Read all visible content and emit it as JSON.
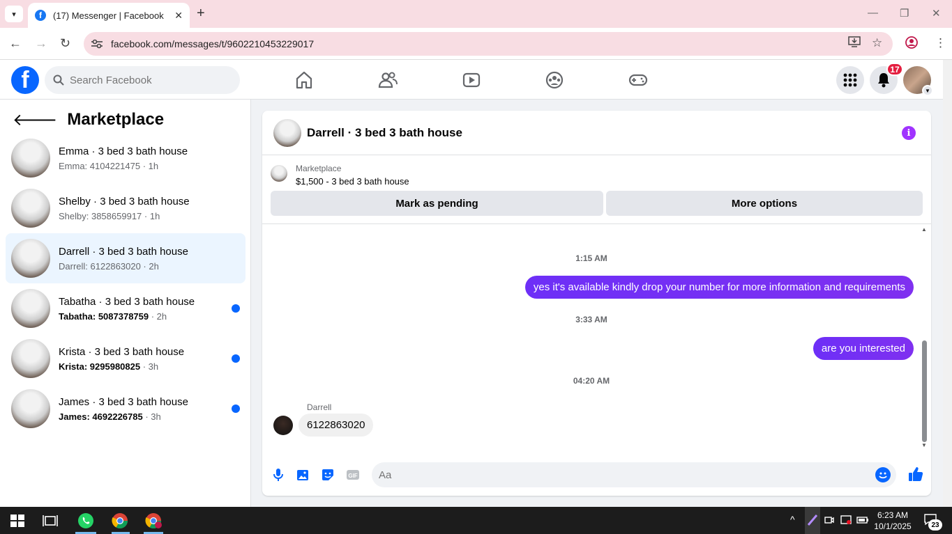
{
  "browser": {
    "tab_title": "(17) Messenger | Facebook",
    "url": "facebook.com/messages/t/9602210453229017"
  },
  "header": {
    "search_placeholder": "Search Facebook",
    "notifications_count": "17",
    "brand_color": "#0866ff"
  },
  "sidebar": {
    "title": "Marketplace",
    "conversations": [
      {
        "name": "Emma · 3 bed 3 bath house",
        "preview": "Emma: 4104221475",
        "time": " · 1h",
        "unread": false,
        "active": false
      },
      {
        "name": "Shelby · 3 bed 3 bath house",
        "preview": "Shelby: 3858659917",
        "time": " · 1h",
        "unread": false,
        "active": false
      },
      {
        "name": "Darrell · 3 bed 3 bath house",
        "preview": "Darrell: 6122863020",
        "time": " · 2h",
        "unread": false,
        "active": true
      },
      {
        "name": "Tabatha · 3 bed 3 bath house",
        "preview": "Tabatha: 5087378759",
        "time": " · 2h",
        "unread": true,
        "active": false
      },
      {
        "name": "Krista · 3 bed 3 bath house",
        "preview": "Krista: 9295980825",
        "time": " · 3h",
        "unread": true,
        "active": false
      },
      {
        "name": "James · 3 bed 3 bath house",
        "preview": "James: 4692226785",
        "time": " · 3h",
        "unread": true,
        "active": false
      }
    ]
  },
  "chat": {
    "title": "Darrell · 3 bed 3 bath house",
    "marketplace_label": "Marketplace",
    "listing": "$1,500 - 3 bed 3 bath house",
    "mark_pending": "Mark as pending",
    "more_options": "More options",
    "accent": "#7b2ff7",
    "messages": [
      {
        "stamp": "1:15 AM"
      },
      {
        "out": "yes it's available kindly drop your number for more information and requirements"
      },
      {
        "stamp": "3:33 AM"
      },
      {
        "out": "are you interested"
      },
      {
        "stamp": "04:20 AM"
      },
      {
        "sender": "Darrell",
        "in": "6122863020"
      }
    ],
    "input_placeholder": "Aa"
  },
  "taskbar": {
    "time": "6:23 AM",
    "date": "10/1/2025",
    "notif_count": "23"
  }
}
